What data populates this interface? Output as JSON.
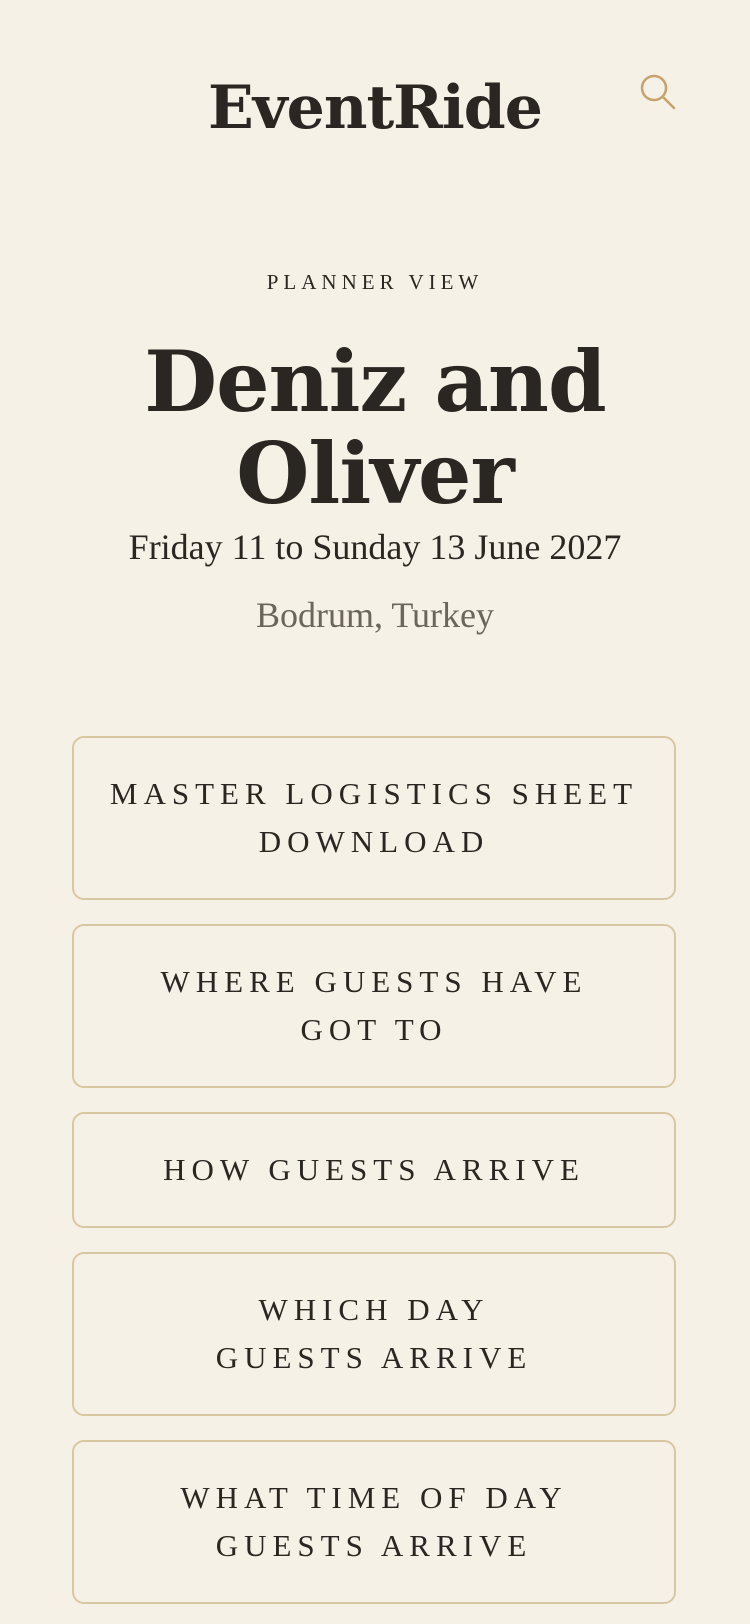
{
  "header": {
    "logo": "EventRide",
    "search_icon": "search-icon",
    "accent_color": "#c7a26b"
  },
  "hero": {
    "eyebrow": "PLANNER VIEW",
    "title": "Deniz and\nOliver",
    "dates": "Friday 11 to Sunday 13 June 2027",
    "location": "Bodrum, Turkey"
  },
  "actions": {
    "master_sheet": "MASTER LOGISTICS SHEET\nDOWNLOAD",
    "where_guests": "WHERE GUESTS HAVE\nGOT TO",
    "how_arrive": "HOW GUESTS ARRIVE",
    "which_day": "WHICH DAY\nGUESTS ARRIVE",
    "what_time": "WHAT TIME OF DAY\nGUESTS ARRIVE"
  }
}
